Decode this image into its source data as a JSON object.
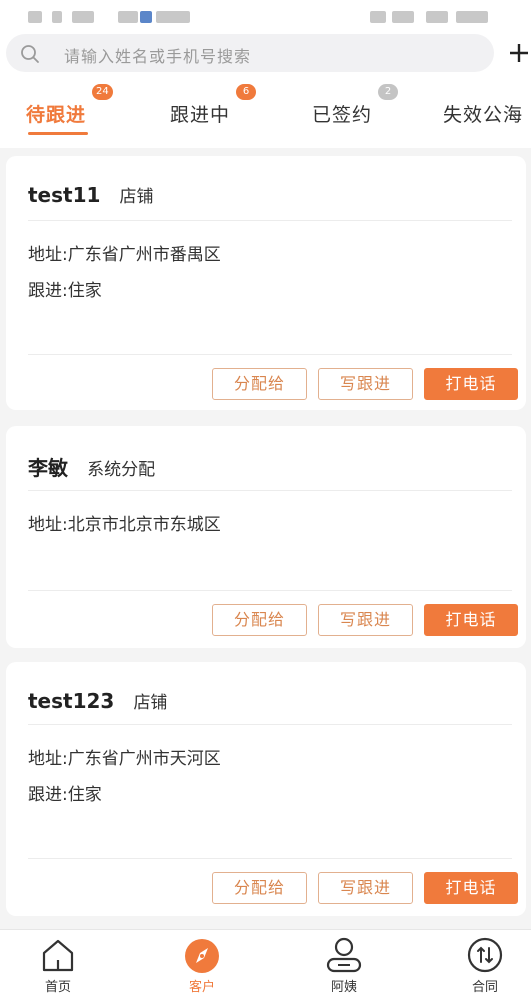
{
  "search": {
    "placeholder": "请输入姓名或手机号搜索"
  },
  "tabs": [
    {
      "label": "待跟进",
      "badge": "24",
      "active": true
    },
    {
      "label": "跟进中",
      "badge": "6",
      "active": false
    },
    {
      "label": "已签约",
      "badge": "2",
      "active": false
    },
    {
      "label": "失效公海",
      "badge": "",
      "active": false
    }
  ],
  "cards": [
    {
      "name": "test11",
      "tag": "店铺",
      "address": "地址:广东省广州市番禺区",
      "follow": "跟进:住家",
      "btn_assign": "分配给",
      "btn_followup": "写跟进",
      "btn_call": "打电话"
    },
    {
      "name": "李敏",
      "tag": "系统分配",
      "address": "地址:北京市北京市东城区",
      "btn_assign": "分配给",
      "btn_followup": "写跟进",
      "btn_call": "打电话"
    },
    {
      "name": "test123",
      "tag": "店铺",
      "address": "地址:广东省广州市天河区",
      "follow": "跟进:住家",
      "btn_assign": "分配给",
      "btn_followup": "写跟进",
      "btn_call": "打电话"
    }
  ],
  "nav": [
    {
      "label": "首页",
      "icon": "home-icon",
      "active": false
    },
    {
      "label": "客户",
      "icon": "compass-icon",
      "active": true
    },
    {
      "label": "阿姨",
      "icon": "person-icon",
      "active": false
    },
    {
      "label": "合同",
      "icon": "contract-icon",
      "active": false
    }
  ],
  "colors": {
    "accent": "#f07a3c",
    "badge_grey": "#c4c4c4",
    "outline_border": "#e2b08f"
  }
}
